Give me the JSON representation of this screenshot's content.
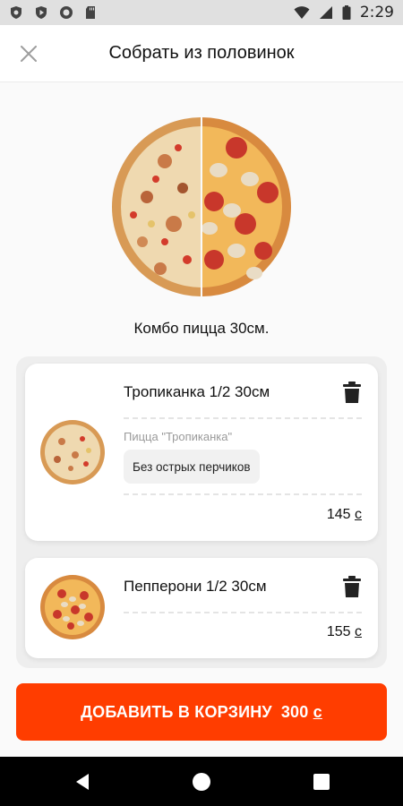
{
  "status_bar": {
    "time": "2:29",
    "icons": [
      "shield-icon",
      "play-store-icon",
      "circle-icon",
      "sd-card-icon",
      "wifi-icon",
      "signal-icon",
      "battery-icon"
    ]
  },
  "header": {
    "title": "Собрать из половинок",
    "close_icon": "close-icon"
  },
  "combo": {
    "title": "Комбо пицца 30см."
  },
  "items": [
    {
      "name": "Тропиканка 1/2 30см",
      "subtitle": "Пицца \"Тропиканка\"",
      "modifier": "Без острых перчиков",
      "price": "145",
      "currency": "с"
    },
    {
      "name": "Пепперони 1/2 30см",
      "price": "155",
      "currency": "с"
    }
  ],
  "cta": {
    "label": "ДОБАВИТЬ В КОРЗИНУ",
    "total": "300",
    "currency": "с"
  },
  "colors": {
    "accent": "#ff3d00",
    "background": "#fafafa",
    "card": "#ffffff"
  },
  "nav_bar": {
    "icons": [
      "back-icon",
      "home-icon",
      "recents-icon"
    ]
  }
}
